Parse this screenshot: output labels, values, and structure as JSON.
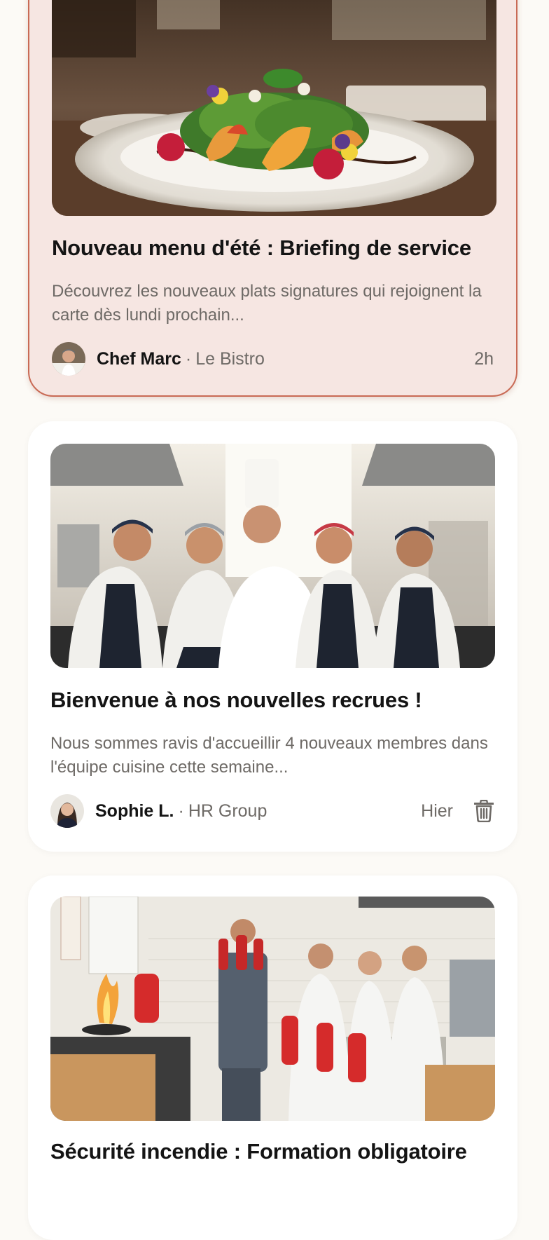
{
  "feed": {
    "posts": [
      {
        "title": "Nouveau menu d'été : Briefing de service",
        "excerpt": "Découvrez les nouveaux plats signatures qui rejoignent la carte dès lundi prochain...",
        "author": "Chef Marc",
        "separator": "·",
        "organization": "Le Bistro",
        "time": "2h",
        "highlighted": true,
        "image": "salad-dish-photo"
      },
      {
        "title": "Bienvenue à nos nouvelles recrues !",
        "excerpt": "Nous sommes ravis d'accueillir 4 nouveaux membres dans l'équipe cuisine cette semaine...",
        "author": "Sophie L.",
        "separator": "·",
        "organization": "HR Group",
        "time": "Hier",
        "highlighted": false,
        "image": "kitchen-team-photo",
        "action_icon": "trash-icon"
      },
      {
        "title": "Sécurité incendie : Formation obligatoire",
        "highlighted": false,
        "image": "fire-safety-training-photo"
      }
    ]
  },
  "colors": {
    "page_background": "#fcfaf6",
    "card_background": "#ffffff",
    "highlight_background": "#f6e6e2",
    "highlight_border": "#c96a55",
    "title_text": "#141414",
    "muted_text": "#6e6a66"
  }
}
